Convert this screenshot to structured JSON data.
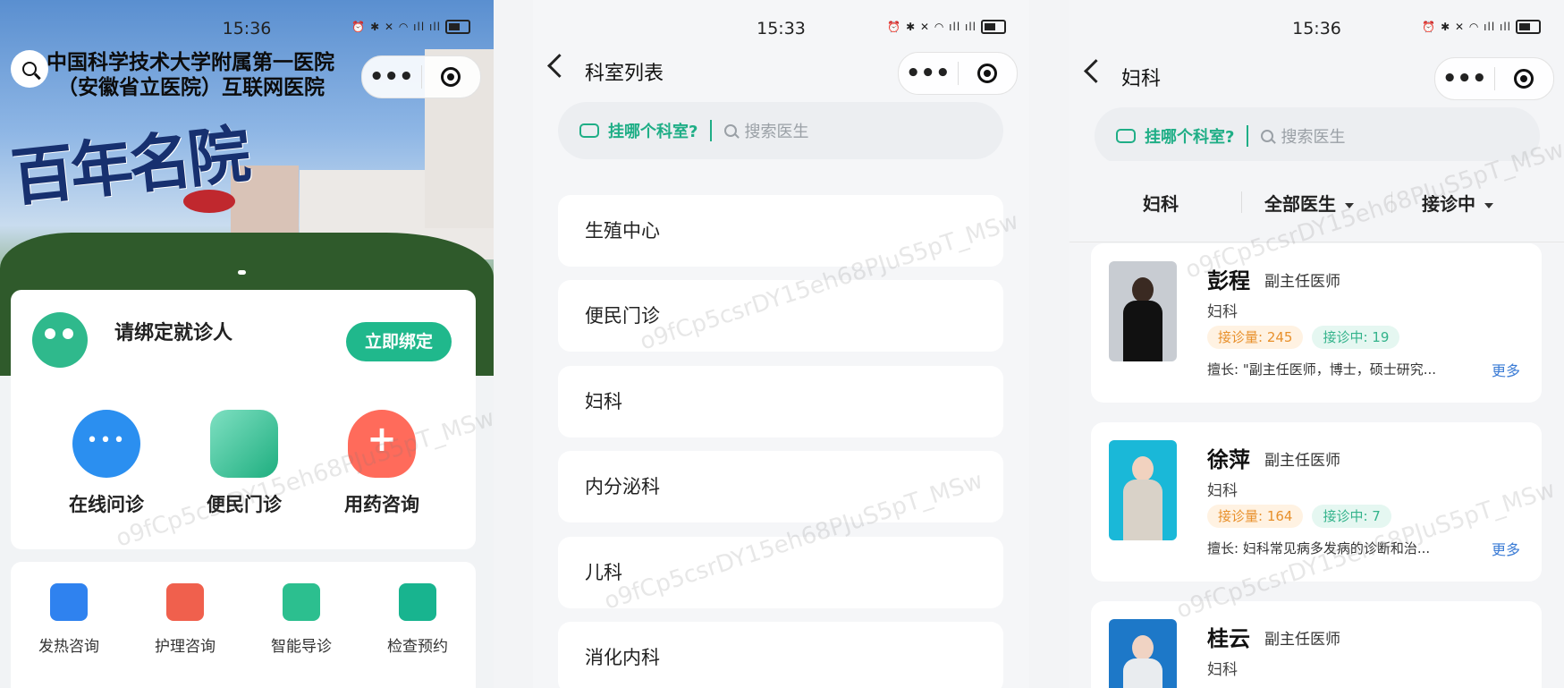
{
  "screens": [
    {
      "status_time": "15:36",
      "hospital_name_line1": "中国科学技术大学附属第一医院",
      "hospital_name_line2": "（安徽省立医院）互联网医院",
      "banner_calligraphy": "百年名院",
      "bind_prompt": "请绑定就诊人",
      "bind_button": "立即绑定",
      "main_services": [
        "在线问诊",
        "便民门诊",
        "用药咨询"
      ],
      "quick_services": [
        "发热咨询",
        "护理咨询",
        "智能导诊",
        "检查预约"
      ],
      "watermark": "o9fCp5csrDY15eh68PJuS5pT_MSw"
    },
    {
      "status_time": "15:33",
      "nav_title": "科室列表",
      "ai_link": "挂哪个科室?",
      "search_placeholder": "搜索医生",
      "departments": [
        "生殖中心",
        "便民门诊",
        "妇科",
        "内分泌科",
        "儿科",
        "消化内科"
      ],
      "watermark": "o9fCp5csrDY15eh68PJuS5pT_MSw"
    },
    {
      "status_time": "15:36",
      "nav_title": "妇科",
      "ai_link": "挂哪个科室?",
      "search_placeholder": "搜索医生",
      "filters": {
        "dept": "妇科",
        "doctor": "全部医生",
        "status": "接诊中"
      },
      "doctors": [
        {
          "name": "彭程",
          "title": "副主任医师",
          "dept": "妇科",
          "consult_count": "接诊量: 245",
          "active_count": "接诊中: 19",
          "skill": "擅长: \"副主任医师，博士，硕士研究...",
          "more": "更多"
        },
        {
          "name": "徐萍",
          "title": "副主任医师",
          "dept": "妇科",
          "consult_count": "接诊量: 164",
          "active_count": "接诊中: 7",
          "skill": "擅长: 妇科常见病多发病的诊断和治...",
          "more": "更多"
        },
        {
          "name": "桂云",
          "title": "副主任医师",
          "dept": "妇科"
        }
      ],
      "watermark": "o9fCp5csrDY15eh68PJuS5pT_MSw"
    }
  ],
  "colors": {
    "accent_green": "#20b88c",
    "link_blue": "#3a7bd5",
    "tag_orange": "#e8902b"
  }
}
